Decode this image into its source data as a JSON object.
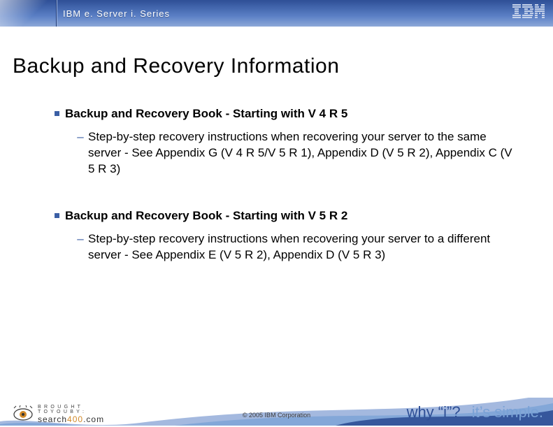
{
  "header": {
    "product": "IBM e. Server i. Series",
    "logo_name": "ibm-logo"
  },
  "slide": {
    "title": "Backup and Recovery Information",
    "bullets": [
      {
        "heading": "Backup and Recovery Book - Starting with V 4 R 5",
        "sub": "Step-by-step recovery instructions when recovering your server to the same server - See Appendix G (V 4 R 5/V 5 R 1), Appendix D (V 5 R 2), Appendix C (V 5 R 3)"
      },
      {
        "heading": "Backup and Recovery Book - Starting with V 5 R 2",
        "sub": "Step-by-step recovery instructions when recovering your server to a different server - See Appendix E (V 5 R 2), Appendix D (V 5 R 3)"
      }
    ]
  },
  "footer": {
    "sponsor_line1": "B R O U G H T",
    "sponsor_line2": "T O  Y O U  B Y :",
    "sponsor_brand_pre": "search",
    "sponsor_brand_accent": "400",
    "sponsor_brand_post": ".com",
    "copyright": "© 2005 IBM Corporation",
    "tagline_q1": "why “i”?",
    "tagline_q2": "it’s simple."
  }
}
